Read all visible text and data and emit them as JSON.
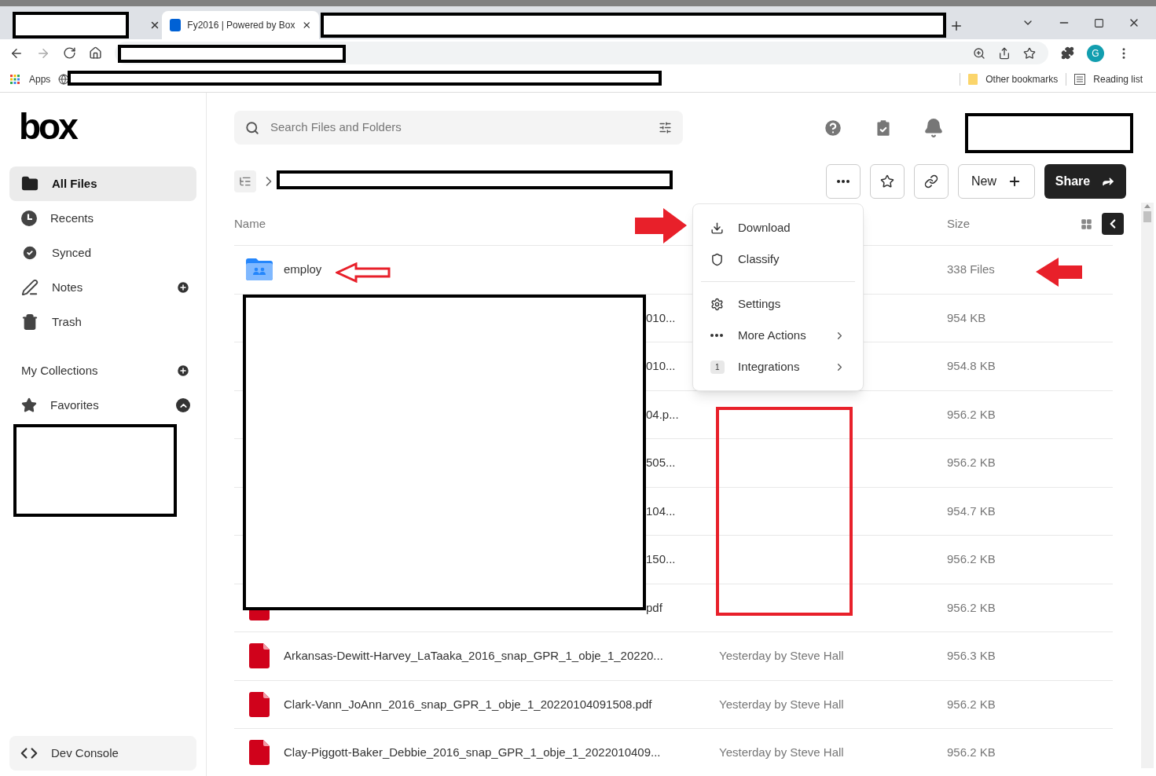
{
  "browser": {
    "tabs": [
      {
        "kind": "redacted",
        "selected": false
      },
      {
        "kind": "page",
        "title": "Fy2016 | Powered by Box",
        "selected": true
      },
      {
        "kind": "redacted",
        "selected": false
      }
    ],
    "profile_initial": "G",
    "bookmarks": {
      "apps": "Apps",
      "other": "Other bookmarks",
      "reading_list": "Reading list"
    }
  },
  "sidebar": {
    "logo": "box",
    "items": [
      {
        "label": "All Files",
        "selected": true,
        "addable": false
      },
      {
        "label": "Recents",
        "selected": false,
        "addable": false
      },
      {
        "label": "Synced",
        "selected": false,
        "addable": false
      },
      {
        "label": "Notes",
        "selected": false,
        "addable": true
      },
      {
        "label": "Trash",
        "selected": false,
        "addable": false
      }
    ],
    "collections_heading": "My Collections",
    "favorites": {
      "label": "Favorites",
      "expanded": true
    },
    "dev_console": "Dev Console"
  },
  "search": {
    "placeholder": "Search Files and Folders"
  },
  "toolbar": {
    "new": "New",
    "share": "Share"
  },
  "table": {
    "columns": {
      "name": "Name",
      "size": "Size"
    },
    "rows": [
      {
        "kind": "folder",
        "name": "employ",
        "size": "338 Files"
      },
      {
        "kind": "redacted",
        "name": "010...",
        "size": "954 KB"
      },
      {
        "kind": "redacted",
        "name": "010...",
        "size": "954.8 KB"
      },
      {
        "kind": "redacted",
        "name": "04.p...",
        "size": "956.2 KB"
      },
      {
        "kind": "redacted",
        "name": "505...",
        "size": "956.2 KB"
      },
      {
        "kind": "redacted",
        "name": "104...",
        "size": "954.7 KB"
      },
      {
        "kind": "redacted",
        "name": "150...",
        "size": "956.2 KB"
      },
      {
        "kind": "redacted_pdf",
        "name": "pdf",
        "size": "956.2 KB"
      },
      {
        "kind": "pdf",
        "name": "Arkansas-Dewitt-Harvey_LaTaaka_2016_snap_GPR_1_obje_1_20220...",
        "modified": "Yesterday by Steve Hall",
        "size": "956.3 KB"
      },
      {
        "kind": "pdf",
        "name": "Clark-Vann_JoAnn_2016_snap_GPR_1_obje_1_20220104091508.pdf",
        "modified": "Yesterday by Steve Hall",
        "size": "956.2 KB"
      },
      {
        "kind": "pdf",
        "name": "Clay-Piggott-Baker_Debbie_2016_snap_GPR_1_obje_1_2022010409...",
        "modified": "Yesterday by Steve Hall",
        "size": "956.2 KB"
      }
    ]
  },
  "context_menu": {
    "items": [
      {
        "kind": "action",
        "label": "Download",
        "submenu": false
      },
      {
        "kind": "action",
        "label": "Classify",
        "submenu": false
      },
      {
        "kind": "divider"
      },
      {
        "kind": "action",
        "label": "Settings",
        "submenu": false
      },
      {
        "kind": "action",
        "label": "More Actions",
        "submenu": true
      },
      {
        "kind": "action",
        "badge": "1",
        "label": "Integrations",
        "submenu": true
      }
    ]
  }
}
